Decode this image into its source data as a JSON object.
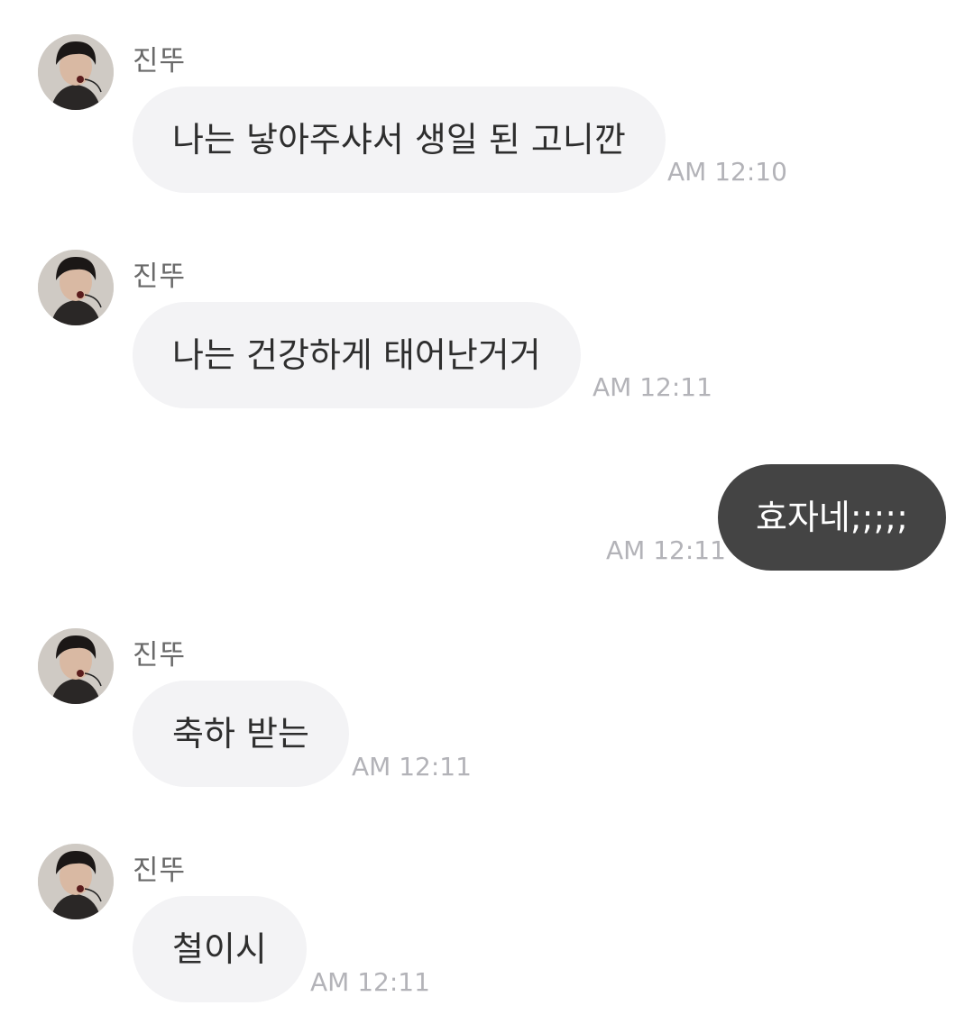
{
  "messages": [
    {
      "sender": "진뚜",
      "text": "나는 낳아주샤서 생일 된 고니깐",
      "time": "AM 12:10"
    },
    {
      "sender": "진뚜",
      "text": "나는 건강하게 태어난거거",
      "time": "AM 12:11"
    },
    {
      "text": "효자네;;;;;",
      "time": "AM 12:11"
    },
    {
      "sender": "진뚜",
      "text": "축하 받는",
      "time": "AM 12:11"
    },
    {
      "sender": "진뚜",
      "text": "철이시",
      "time": "AM 12:11"
    }
  ],
  "colors": {
    "incoming_bubble": "#f3f3f5",
    "outgoing_bubble": "#444444",
    "timestamp": "#b3b3b8",
    "sender_name": "#6a6a6a"
  }
}
